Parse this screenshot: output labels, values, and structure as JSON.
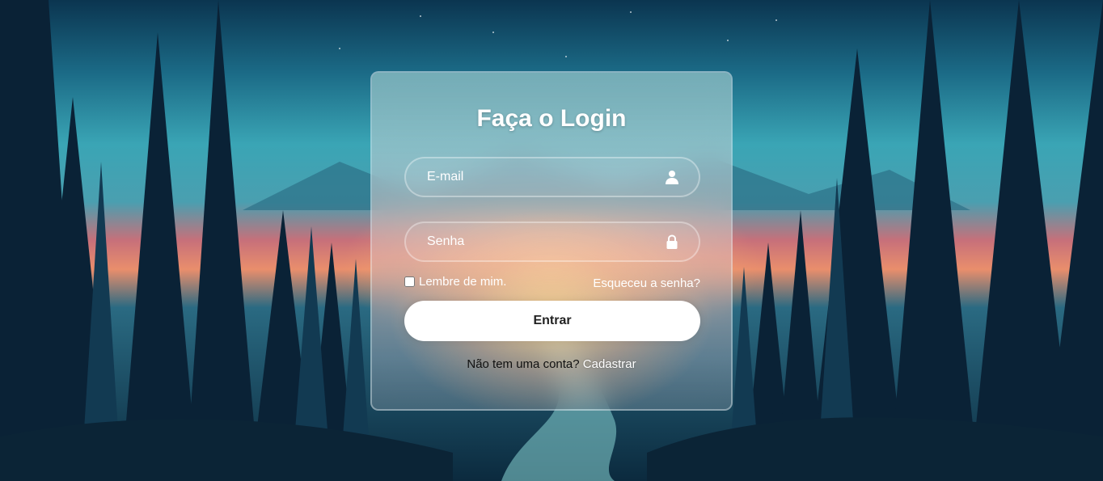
{
  "login": {
    "title": "Faça o Login",
    "email_placeholder": "E-mail",
    "password_placeholder": "Senha",
    "remember_label": "Lembre de mim.",
    "remember_checked": false,
    "forgot_label": "Esqueceu a senha?",
    "submit_label": "Entrar",
    "register_prompt": "Não tem uma conta?",
    "register_link": "Cadastrar"
  },
  "icons": {
    "email_field": "user-icon",
    "password_field": "lock-icon"
  },
  "colors": {
    "button_bg": "#ffffff",
    "text": "#ffffff",
    "card_border": "rgba(255,255,255,0.35)"
  }
}
